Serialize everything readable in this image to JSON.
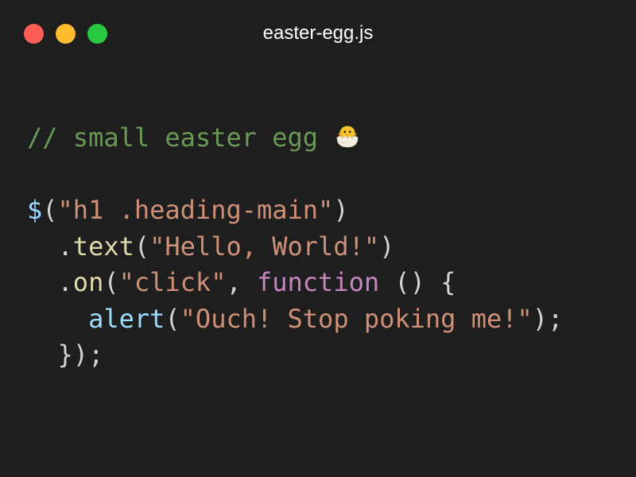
{
  "window": {
    "title": "easter-egg.js",
    "background": "#1e1e1e",
    "traffic_lights": [
      {
        "name": "close",
        "color": "#ff5f57"
      },
      {
        "name": "minimize",
        "color": "#febc2e"
      },
      {
        "name": "zoom",
        "color": "#28c840"
      }
    ]
  },
  "code": {
    "colors": {
      "comment": "#6a9955",
      "default": "#d4d4d4",
      "string": "#ce9178",
      "identifier": "#9cdcfe",
      "method": "#dcdcaa",
      "keyword": "#c586c0"
    },
    "emoji_icon": "hatching-chick-icon",
    "lines": [
      [
        {
          "text": "// small easter egg ",
          "type": "comment"
        },
        {
          "icon": "hatching-chick-icon"
        }
      ],
      [],
      [
        {
          "text": "$",
          "type": "identifier"
        },
        {
          "text": "(",
          "type": "default"
        },
        {
          "text": "\"h1 .heading-main\"",
          "type": "string"
        },
        {
          "text": ")",
          "type": "default"
        }
      ],
      [
        {
          "text": "  .",
          "type": "default"
        },
        {
          "text": "text",
          "type": "method"
        },
        {
          "text": "(",
          "type": "default"
        },
        {
          "text": "\"Hello, World!\"",
          "type": "string"
        },
        {
          "text": ")",
          "type": "default"
        }
      ],
      [
        {
          "text": "  .",
          "type": "default"
        },
        {
          "text": "on",
          "type": "method"
        },
        {
          "text": "(",
          "type": "default"
        },
        {
          "text": "\"click\"",
          "type": "string"
        },
        {
          "text": ", ",
          "type": "default"
        },
        {
          "text": "function",
          "type": "keyword"
        },
        {
          "text": " () {",
          "type": "default"
        }
      ],
      [
        {
          "text": "    ",
          "type": "default"
        },
        {
          "text": "alert",
          "type": "identifier"
        },
        {
          "text": "(",
          "type": "default"
        },
        {
          "text": "\"Ouch! Stop poking me!\"",
          "type": "string"
        },
        {
          "text": ");",
          "type": "default"
        }
      ],
      [
        {
          "text": "  });",
          "type": "default"
        }
      ]
    ]
  }
}
